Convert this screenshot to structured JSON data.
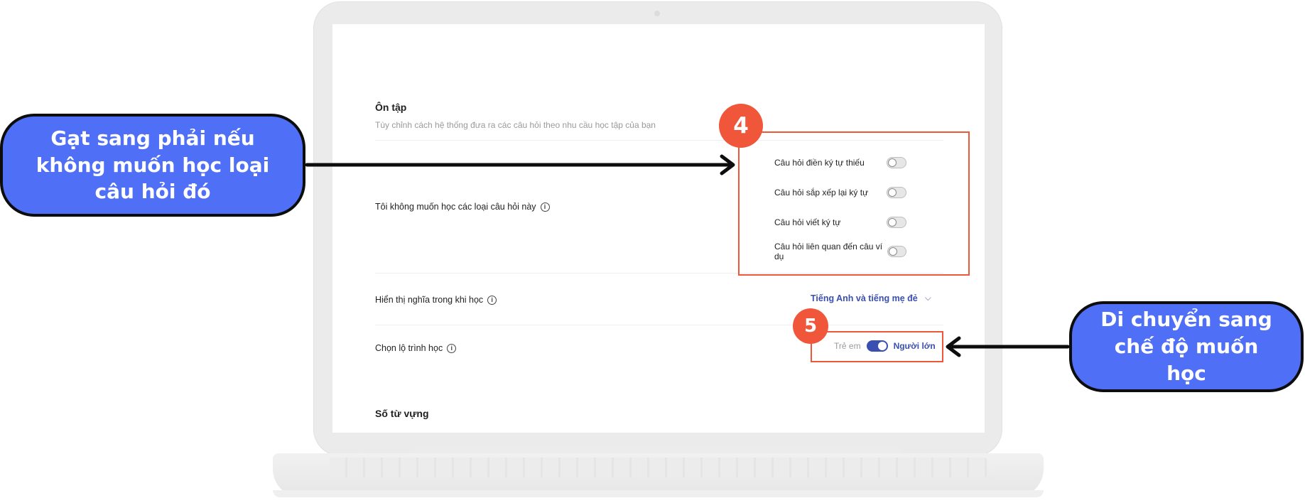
{
  "review_section": {
    "title": "Ôn tập",
    "description": "Tùy chỉnh cách hệ thống đưa ra các câu hỏi theo nhu cầu học tập của bạn"
  },
  "exclude_questions": {
    "label": "Tôi không muốn học các loại câu hỏi này",
    "items": [
      {
        "label": "Câu hỏi điền ký tự thiếu",
        "enabled": false
      },
      {
        "label": "Câu hỏi sắp xếp lại ký tự",
        "enabled": false
      },
      {
        "label": "Câu hỏi viết ký tự",
        "enabled": false
      },
      {
        "label": "Câu hỏi liên quan đến câu ví dụ",
        "enabled": false
      }
    ]
  },
  "meaning_display": {
    "label": "Hiển thị nghĩa trong khi học",
    "selected": "Tiếng Anh và tiếng mẹ đẻ"
  },
  "learning_path": {
    "label": "Chọn lộ trình học",
    "option_left": "Trẻ em",
    "option_right": "Người lớn",
    "selected": "Người lớn"
  },
  "vocab_section": {
    "title": "Số từ vựng"
  },
  "annotations": {
    "step4": "4",
    "step5": "5",
    "callout_left": "Gạt sang phải nếu không muốn học loại câu hỏi đó",
    "callout_right": "Di chuyển sang chế độ muốn học"
  },
  "colors": {
    "accent": "#3a4fb0",
    "annotation_red": "#f0563a",
    "callout_blue": "#4f70f6"
  },
  "icons": {
    "info": "info-icon",
    "chevron": "chevron-down-icon"
  }
}
